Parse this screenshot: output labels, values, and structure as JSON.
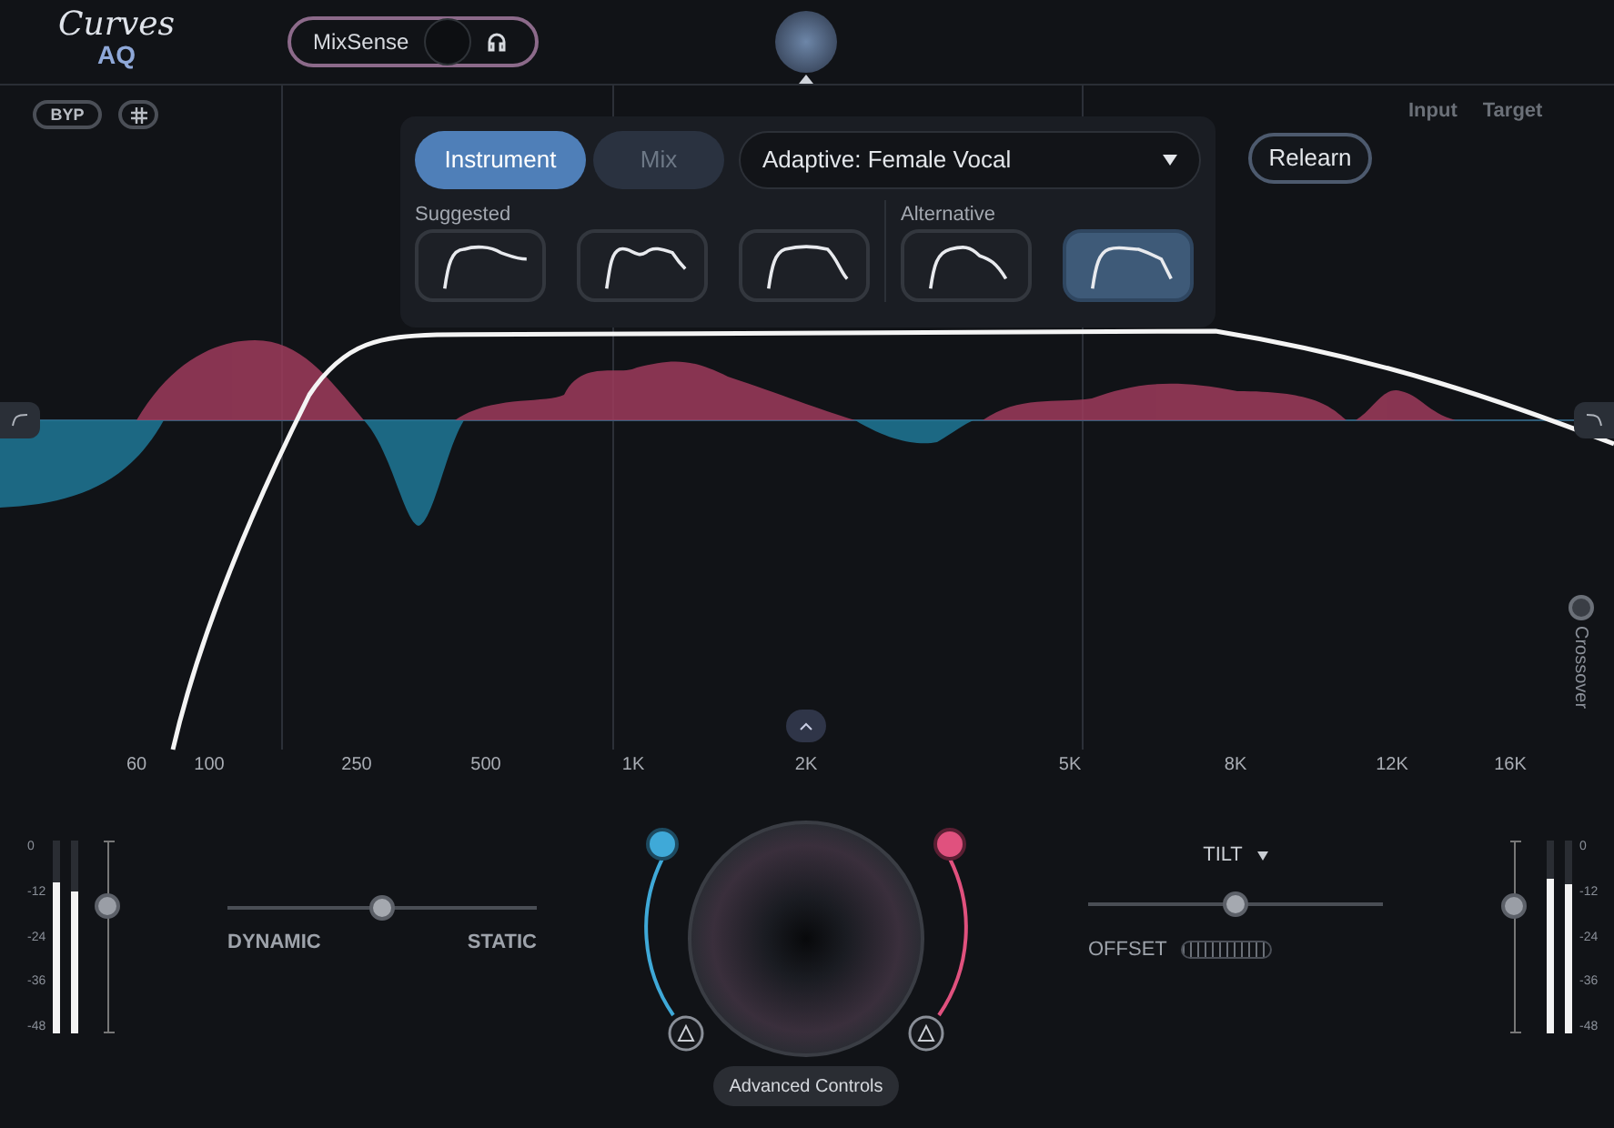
{
  "logo": {
    "word": "Curves",
    "badge": "AQ"
  },
  "mixsense": {
    "label": "MixSense"
  },
  "bypass": {
    "label": "BYP"
  },
  "legend": [
    "Input",
    "Target"
  ],
  "panel": {
    "tabs": [
      {
        "label": "Instrument",
        "selected": true
      },
      {
        "label": "Mix",
        "selected": false
      }
    ],
    "profile": {
      "value": "Adaptive: Female Vocal"
    },
    "groups": [
      {
        "title": "Suggested",
        "presets": [
          {
            "selected": false
          },
          {
            "selected": false
          },
          {
            "selected": false
          }
        ]
      },
      {
        "title": "Alternative",
        "presets": [
          {
            "selected": false
          },
          {
            "selected": true
          }
        ]
      }
    ]
  },
  "relearn": {
    "label": "Relearn"
  },
  "frequency_labels": [
    "60",
    "100",
    "250",
    "500",
    "1K",
    "2K",
    "5K",
    "8K",
    "12K",
    "16K"
  ],
  "crossover": {
    "label": "Crossover",
    "on": false
  },
  "meter_left": {
    "scale": [
      "0",
      "-12",
      "-24",
      "-36",
      "-48"
    ],
    "channels": [
      {
        "level": 0.78
      },
      {
        "level": 0.74
      }
    ],
    "fader": {
      "level": 0.66
    }
  },
  "character": {
    "left": "DYNAMIC",
    "right": "STATIC",
    "level": 0.5
  },
  "tilt": {
    "label": "TILT",
    "level": 0.5,
    "offset_label": "OFFSET"
  },
  "meter_right": {
    "scale": [
      "0",
      "-12",
      "-24",
      "-36",
      "-48"
    ],
    "channels": [
      {
        "level": 0.8
      },
      {
        "level": 0.77
      }
    ],
    "fader": {
      "level": 0.66
    }
  },
  "advanced": {
    "label": "Advanced Controls"
  }
}
